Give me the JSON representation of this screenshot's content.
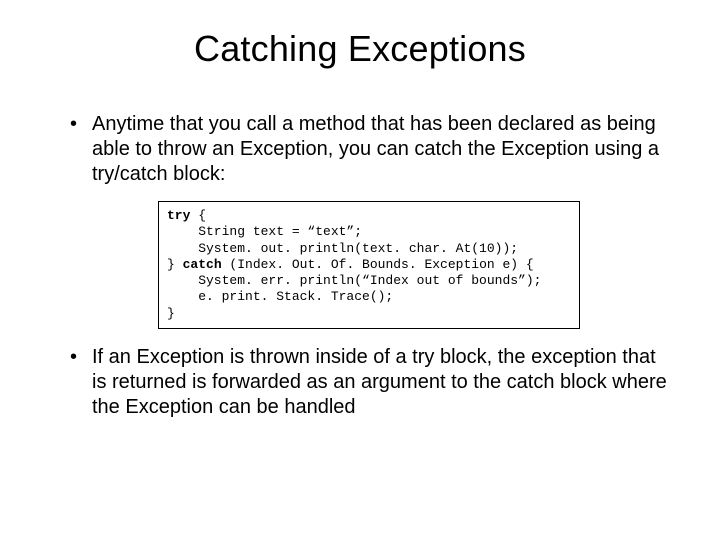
{
  "title": "Catching Exceptions",
  "bullets": {
    "first": "Anytime that you call a method that has been declared as being able to throw an Exception, you can catch the Exception using a try/catch block:",
    "second": "If an Exception is thrown inside of a try block, the exception that is returned is forwarded as an argument to the catch block where the Exception can be handled"
  },
  "code": {
    "l1_kw": "try",
    "l1_rest": " {",
    "l2": "    String text = “text”;",
    "l3": "    System. out. println(text. char. At(10));",
    "l4_prefix": "} ",
    "l4_kw": "catch",
    "l4_rest": " (Index. Out. Of. Bounds. Exception e) {",
    "l5": "    System. err. println(“Index out of bounds”);",
    "l6": "    e. print. Stack. Trace();",
    "l7": "}"
  }
}
